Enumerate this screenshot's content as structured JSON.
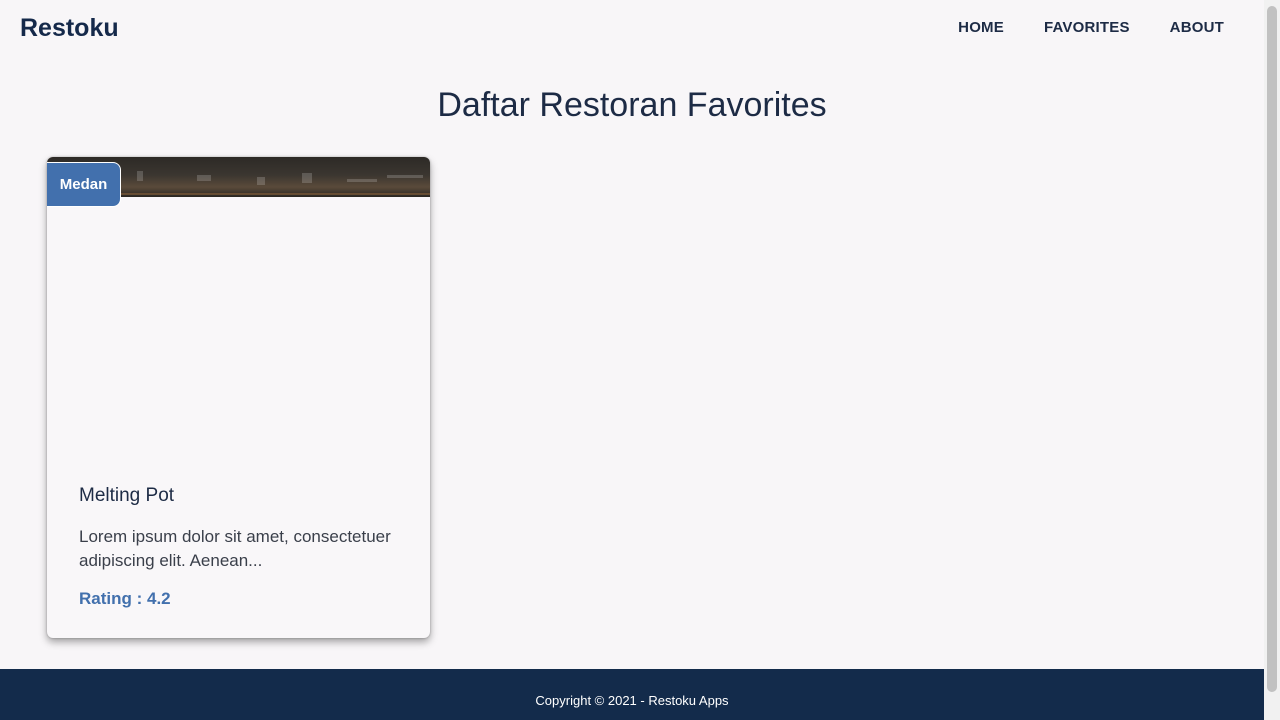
{
  "header": {
    "brand": "Restoku",
    "nav": [
      {
        "label": "HOME"
      },
      {
        "label": "FAVORITES"
      },
      {
        "label": "ABOUT"
      }
    ]
  },
  "main": {
    "title": "Daftar Restoran Favorites",
    "restaurants": [
      {
        "city": "Medan",
        "name": "Melting Pot",
        "description": "Lorem ipsum dolor sit amet, consectetuer adipiscing elit. Aenean...",
        "rating": "Rating : 4.2"
      }
    ]
  },
  "footer": {
    "copyright": "Copyright © 2021 - Restoku Apps"
  },
  "colors": {
    "accent": "#4270ad",
    "footer": "#132b4b",
    "background": "#f8f6f8"
  }
}
